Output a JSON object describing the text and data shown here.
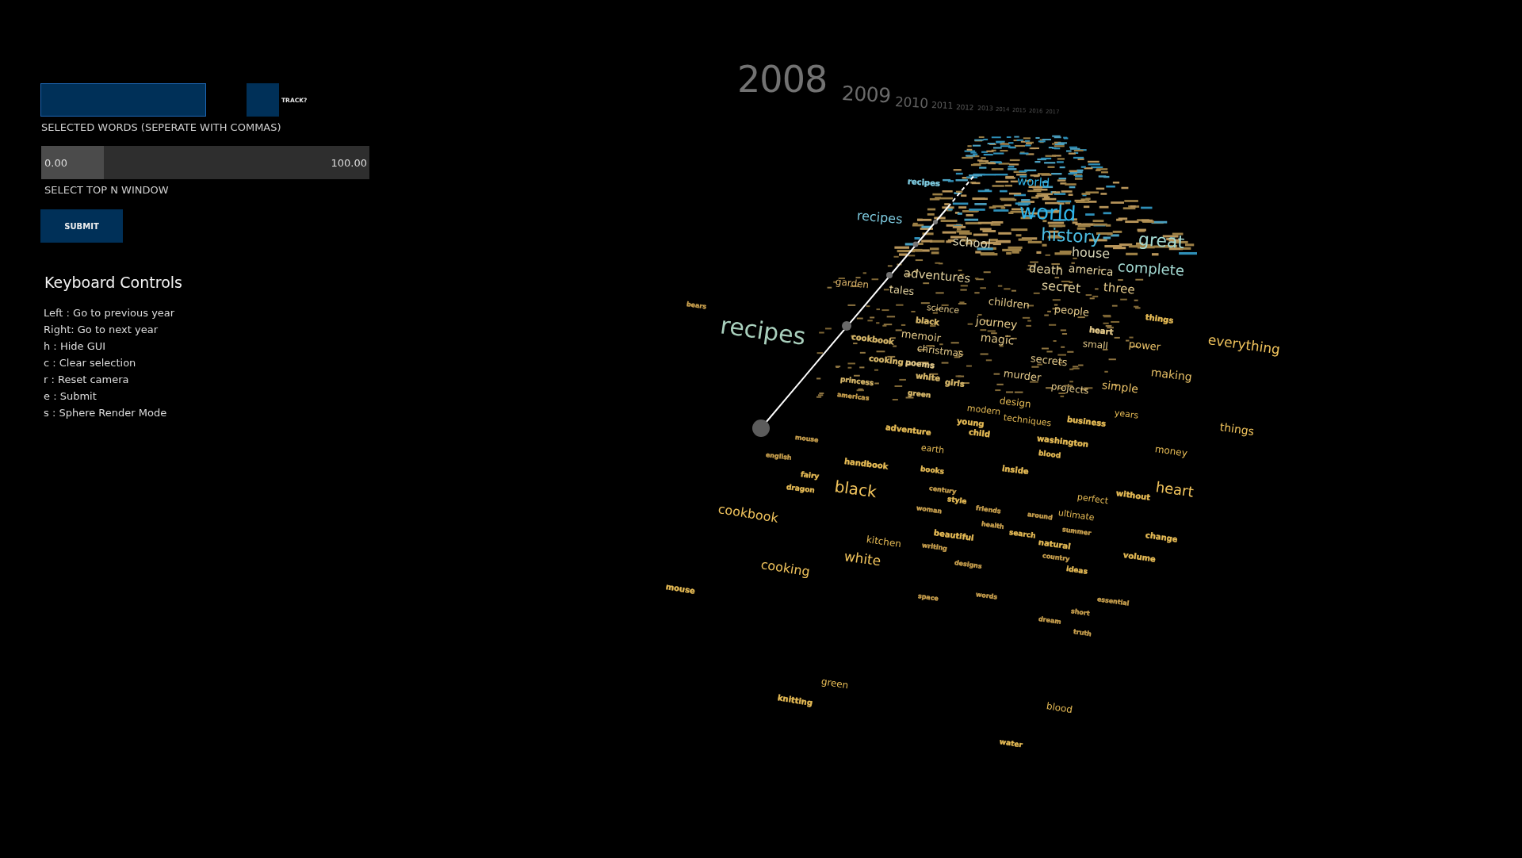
{
  "gui": {
    "selected_words": {
      "label": "SELECTED WORDS (SEPERATE WITH COMMAS)"
    },
    "track": {
      "label": "TRACK?",
      "checked": false
    },
    "top_n_window": {
      "min_value": "0.00",
      "max_value": "100.00",
      "level": 0.19,
      "label": "SELECT TOP N WINDOW"
    },
    "submit_button": "SUBMIT"
  },
  "keyboard_controls": {
    "title": "Keyboard Controls",
    "items": [
      "Left : Go to previous year",
      "Right: Go to next year",
      "h : Hide GUI",
      "c : Clear selection",
      "r : Reset camera",
      "e : Submit",
      "s : Sphere Render Mode"
    ]
  },
  "scene": {
    "years": [
      "2008",
      "2009",
      "2010",
      "2011",
      "2012",
      "2013",
      "2014",
      "2015",
      "2016",
      "2017"
    ],
    "words": [
      {
        "text": "recipes",
        "color": "#a9d0bd"
      },
      {
        "text": "bears",
        "color": "#c9a04e"
      },
      {
        "text": "garden",
        "color": "#dcb46a"
      },
      {
        "text": "tales",
        "color": "#e0cf9c"
      },
      {
        "text": "adventures",
        "color": "#e0cf9c"
      },
      {
        "text": "school",
        "color": "#dcd6b4"
      },
      {
        "text": "recipes",
        "color": "#7ecbe0"
      },
      {
        "text": "recipes",
        "color": "#7ecbe0"
      },
      {
        "text": "world",
        "color": "#2fb4e8"
      },
      {
        "text": "history",
        "color": "#4bbde3"
      },
      {
        "text": "world",
        "color": "#2fb4e8"
      },
      {
        "text": "great",
        "color": "#a3d9d2"
      },
      {
        "text": "complete",
        "color": "#a3d9d2"
      },
      {
        "text": "house",
        "color": "#d9d6b8"
      },
      {
        "text": "death",
        "color": "#e3d2a0"
      },
      {
        "text": "america",
        "color": "#e3d2a0"
      },
      {
        "text": "secret",
        "color": "#e3d2a0"
      },
      {
        "text": "three",
        "color": "#e3c98a"
      },
      {
        "text": "people",
        "color": "#e3c98a"
      },
      {
        "text": "children",
        "color": "#e3c98a"
      },
      {
        "text": "journey",
        "color": "#e3c98a"
      },
      {
        "text": "science",
        "color": "#e3c98a"
      },
      {
        "text": "black",
        "color": "#d8b86a"
      },
      {
        "text": "memoir",
        "color": "#e3c98a"
      },
      {
        "text": "magic",
        "color": "#e3c98a"
      },
      {
        "text": "christmas",
        "color": "#e3c98a"
      },
      {
        "text": "cookbook",
        "color": "#d8b86a"
      },
      {
        "text": "cooking",
        "color": "#d8b86a"
      },
      {
        "text": "poems",
        "color": "#e3c98a"
      },
      {
        "text": "secrets",
        "color": "#e3c98a"
      },
      {
        "text": "murder",
        "color": "#e3c98a"
      },
      {
        "text": "small",
        "color": "#e3c98a"
      },
      {
        "text": "heart",
        "color": "#e3c98a"
      },
      {
        "text": "power",
        "color": "#e8c066"
      },
      {
        "text": "simple",
        "color": "#e8c066"
      },
      {
        "text": "making",
        "color": "#e8c066"
      },
      {
        "text": "projects",
        "color": "#e3c98a"
      },
      {
        "text": "white",
        "color": "#d8b86a"
      },
      {
        "text": "girls",
        "color": "#d8b86a"
      },
      {
        "text": "princess",
        "color": "#d8b86a"
      },
      {
        "text": "green",
        "color": "#d8b86a"
      },
      {
        "text": "americas",
        "color": "#c9a04e"
      },
      {
        "text": "design",
        "color": "#e6bb55"
      },
      {
        "text": "modern",
        "color": "#e6bb55"
      },
      {
        "text": "techniques",
        "color": "#e6bb55"
      },
      {
        "text": "business",
        "color": "#e6bb55"
      },
      {
        "text": "years",
        "color": "#e6bb55"
      },
      {
        "text": "adventure",
        "color": "#e6bb55"
      },
      {
        "text": "young",
        "color": "#e6bb55"
      },
      {
        "text": "child",
        "color": "#e6bb55"
      },
      {
        "text": "washington",
        "color": "#e6bb55"
      },
      {
        "text": "blood",
        "color": "#e6bb55"
      },
      {
        "text": "earth",
        "color": "#e6bb55"
      },
      {
        "text": "inside",
        "color": "#e6bb55"
      },
      {
        "text": "books",
        "color": "#e6bb55"
      },
      {
        "text": "handbook",
        "color": "#e6bb55"
      },
      {
        "text": "english",
        "color": "#c9a04e"
      },
      {
        "text": "mouse",
        "color": "#c9a04e"
      },
      {
        "text": "fairy",
        "color": "#e6bb55"
      },
      {
        "text": "dragon",
        "color": "#e6bb55"
      },
      {
        "text": "black",
        "color": "#f0c35c"
      },
      {
        "text": "cookbook",
        "color": "#f0c35c"
      },
      {
        "text": "kitchen",
        "color": "#e6bb55"
      },
      {
        "text": "white",
        "color": "#f0c35c"
      },
      {
        "text": "cooking",
        "color": "#f0c35c"
      },
      {
        "text": "mouse",
        "color": "#e6bb55"
      },
      {
        "text": "century",
        "color": "#c9a04e"
      },
      {
        "text": "style",
        "color": "#e6bb55"
      },
      {
        "text": "woman",
        "color": "#c9a04e"
      },
      {
        "text": "friends",
        "color": "#c9a04e"
      },
      {
        "text": "health",
        "color": "#c9a04e"
      },
      {
        "text": "around",
        "color": "#c9a04e"
      },
      {
        "text": "ultimate",
        "color": "#e6bb55"
      },
      {
        "text": "perfect",
        "color": "#e6bb55"
      },
      {
        "text": "without",
        "color": "#e6bb55"
      },
      {
        "text": "heart",
        "color": "#f0c35c"
      },
      {
        "text": "money",
        "color": "#e6bb55"
      },
      {
        "text": "things",
        "color": "#f0c35c"
      },
      {
        "text": "everything",
        "color": "#f0c35c"
      },
      {
        "text": "things",
        "color": "#e6bb55"
      },
      {
        "text": "beautiful",
        "color": "#e6bb55"
      },
      {
        "text": "writing",
        "color": "#c9a04e"
      },
      {
        "text": "search",
        "color": "#e6bb55"
      },
      {
        "text": "summer",
        "color": "#c9a04e"
      },
      {
        "text": "natural",
        "color": "#e6bb55"
      },
      {
        "text": "country",
        "color": "#c9a04e"
      },
      {
        "text": "change",
        "color": "#e6bb55"
      },
      {
        "text": "volume",
        "color": "#e6bb55"
      },
      {
        "text": "ideas",
        "color": "#e6bb55"
      },
      {
        "text": "designs",
        "color": "#c9a04e"
      },
      {
        "text": "space",
        "color": "#c9a04e"
      },
      {
        "text": "words",
        "color": "#c9a04e"
      },
      {
        "text": "essential",
        "color": "#c9a04e"
      },
      {
        "text": "short",
        "color": "#c9a04e"
      },
      {
        "text": "dream",
        "color": "#c9a04e"
      },
      {
        "text": "truth",
        "color": "#c9a04e"
      },
      {
        "text": "green",
        "color": "#e6bb55"
      },
      {
        "text": "knitting",
        "color": "#e6bb55"
      },
      {
        "text": "blood",
        "color": "#e6bb55"
      },
      {
        "text": "water",
        "color": "#e6bb55"
      }
    ]
  }
}
